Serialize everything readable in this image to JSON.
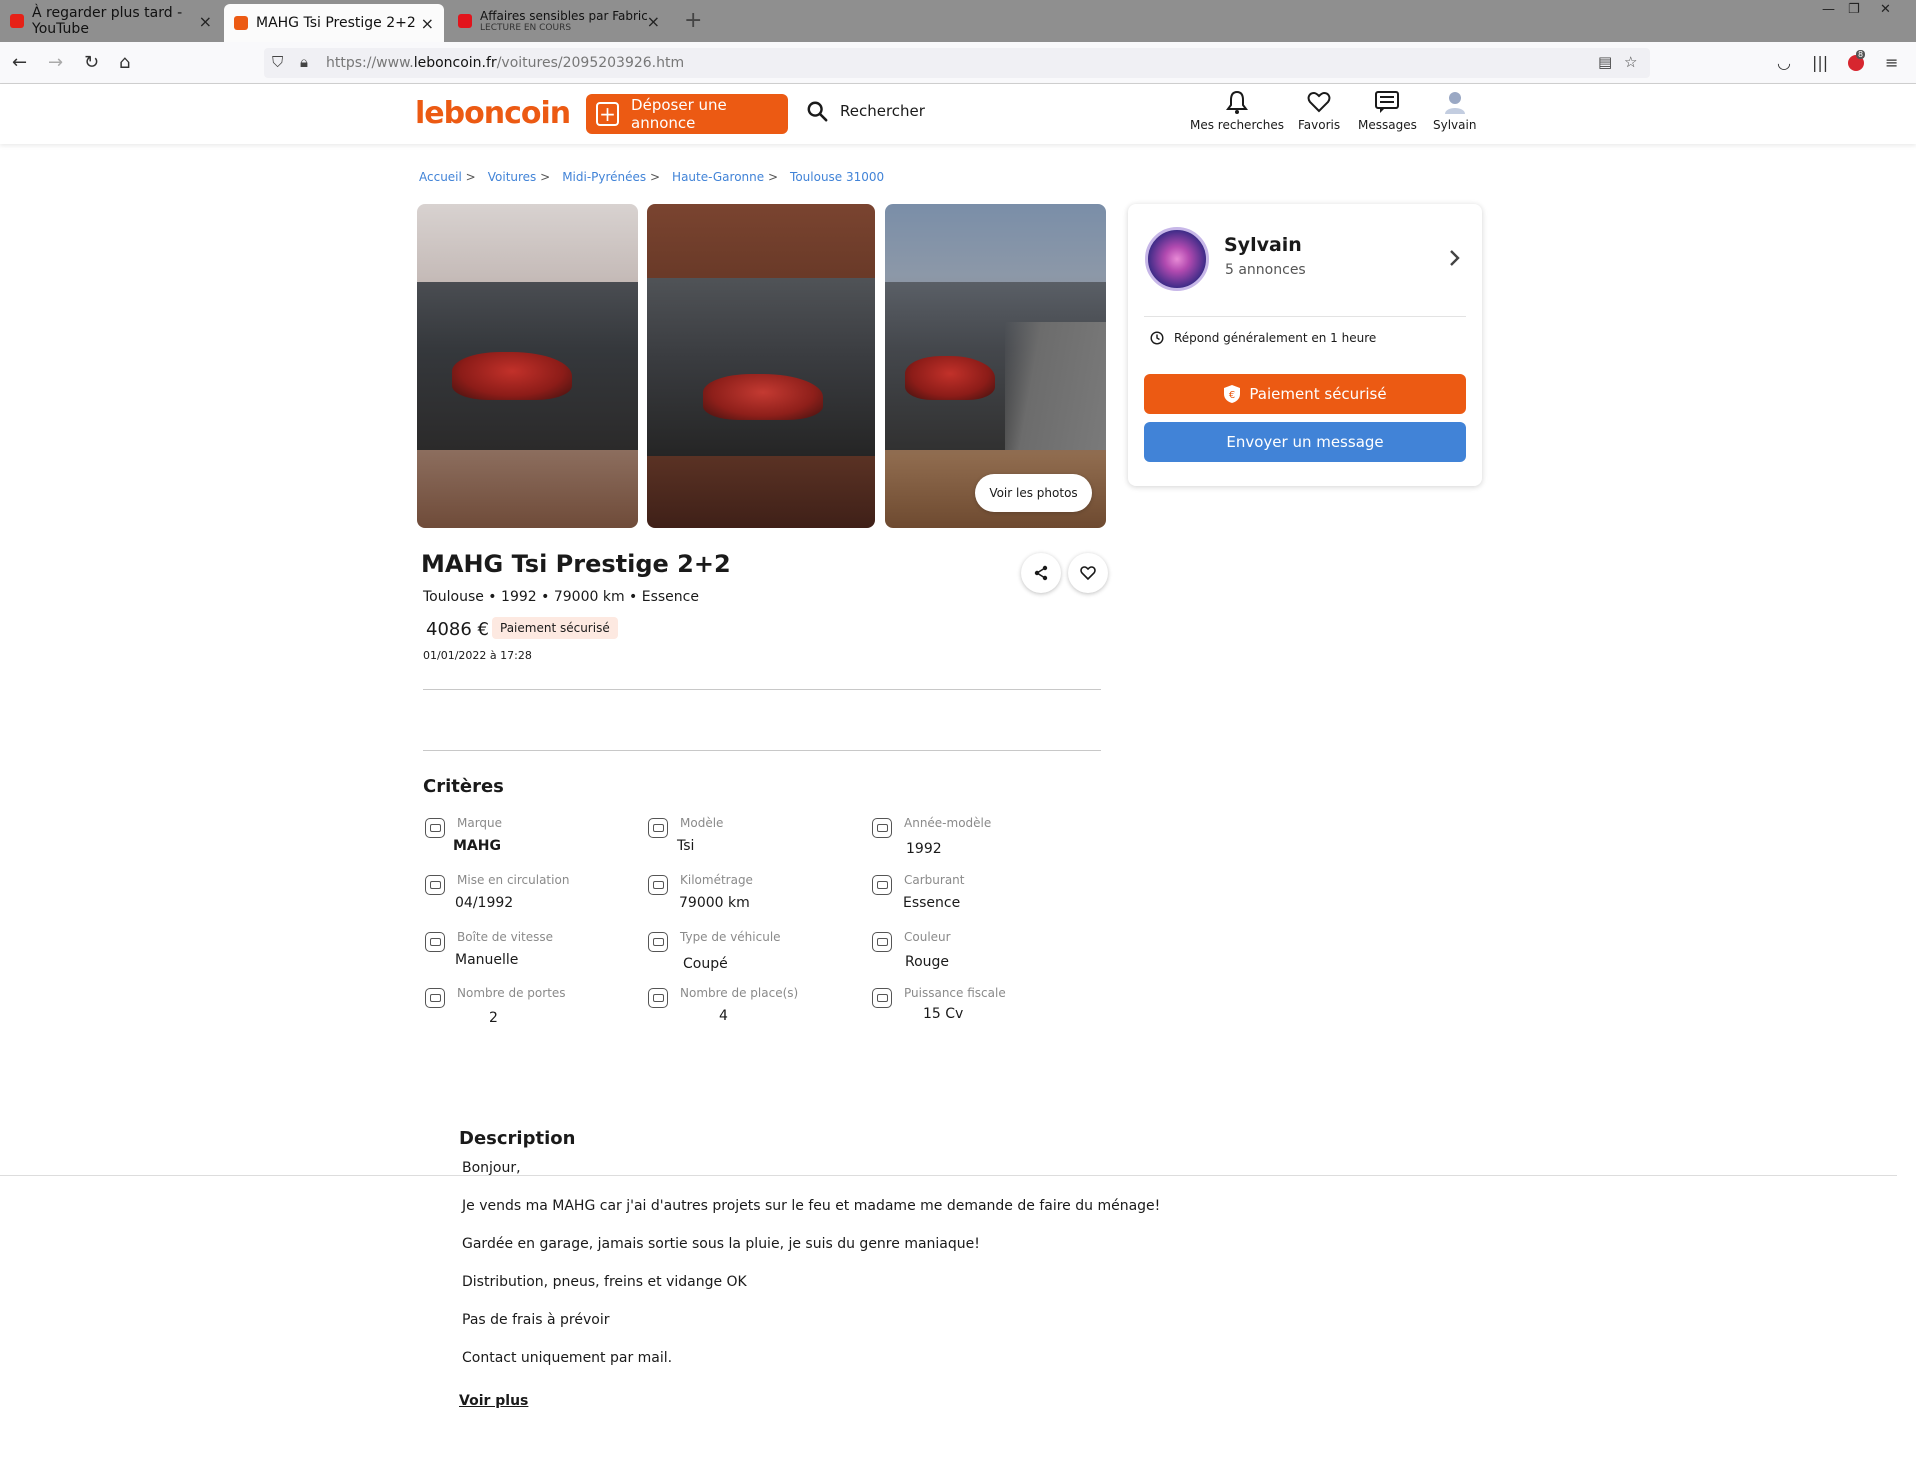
{
  "browser": {
    "tabs": [
      {
        "title": "À regarder plus tard - YouTube",
        "color": "#e62117"
      },
      {
        "title": "MAHG Tsi Prestige 2+2",
        "color": "#ec5a13"
      },
      {
        "title": "Affaires sensibles par Fabrice Dr",
        "subtitle": "LECTURE EN COURS",
        "color": "#e2141c"
      }
    ],
    "url_prefix": "https://www.",
    "url_domain": "leboncoin.fr",
    "url_path": "/voitures/2095203926.htm",
    "badge_count": "8"
  },
  "header": {
    "logo": "leboncoin",
    "deposit_label": "Déposer une annonce",
    "search_label": "Rechercher",
    "nav": [
      {
        "label": "Mes recherches",
        "icon": "bell-icon"
      },
      {
        "label": "Favoris",
        "icon": "heart-icon"
      },
      {
        "label": "Messages",
        "icon": "message-icon"
      },
      {
        "label": "Sylvain",
        "icon": "user-icon"
      }
    ],
    "accent": "#ec5a13"
  },
  "breadcrumb": [
    "Accueil",
    "Voitures",
    "Midi-Pyrénées",
    "Haute-Garonne",
    "Toulouse 31000"
  ],
  "gallery": {
    "voir_photos": "Voir les photos"
  },
  "listing": {
    "title": "MAHG Tsi Prestige 2+2",
    "location": "Toulouse",
    "year": "1992",
    "mileage": "79000 km",
    "fuel": "Essence",
    "price": "4086 €",
    "payment_badge": "Paiement sécurisé",
    "date": "01/01/2022 à 17:28"
  },
  "criteria": {
    "title": "Critères",
    "items": [
      {
        "label": "Marque",
        "value": "MAHG"
      },
      {
        "label": "Modèle",
        "value": "Tsi"
      },
      {
        "label": "Année-modèle",
        "value": "1992"
      },
      {
        "label": "Mise en circulation",
        "value": "04/1992"
      },
      {
        "label": "Kilométrage",
        "value": "79000 km"
      },
      {
        "label": "Carburant",
        "value": "Essence"
      },
      {
        "label": "Boîte de vitesse",
        "value": "Manuelle"
      },
      {
        "label": "Type de véhicule",
        "value": "Coupé"
      },
      {
        "label": "Couleur",
        "value": "Rouge"
      },
      {
        "label": "Nombre de portes",
        "value": "2"
      },
      {
        "label": "Nombre de place(s)",
        "value": "4"
      },
      {
        "label": "Puissance fiscale",
        "value": "15 Cv"
      }
    ]
  },
  "description": {
    "title": "Description",
    "lines": [
      "Bonjour,",
      "Je vends ma MAHG car j'ai d'autres projets sur le feu et madame me demande de faire du ménage!",
      "Gardée en garage, jamais sortie sous la pluie, je suis du genre maniaque!",
      "Distribution, pneus, freins et vidange OK",
      "Pas de frais à prévoir",
      "Contact uniquement par mail."
    ],
    "more": "Voir plus"
  },
  "seller": {
    "name": "Sylvain",
    "ads": "5 annonces",
    "reply": "Répond généralement en 1 heure",
    "pay_button": "Paiement sécurisé",
    "message_button": "Envoyer un message",
    "blue": "#4183d7"
  }
}
